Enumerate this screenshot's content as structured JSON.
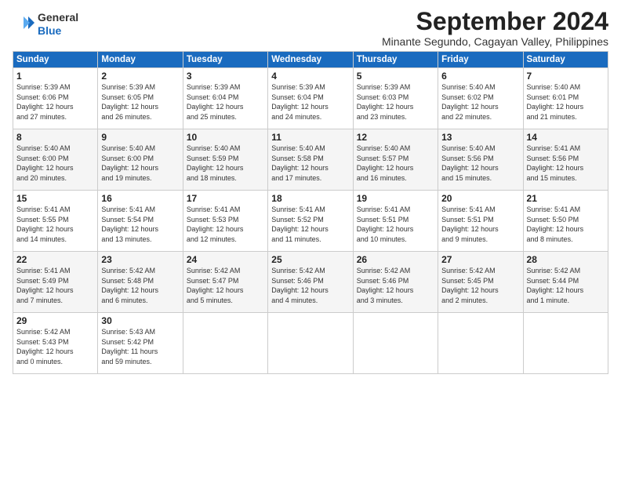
{
  "header": {
    "logo_line1": "General",
    "logo_line2": "Blue",
    "month_title": "September 2024",
    "location": "Minante Segundo, Cagayan Valley, Philippines"
  },
  "days_of_week": [
    "Sunday",
    "Monday",
    "Tuesday",
    "Wednesday",
    "Thursday",
    "Friday",
    "Saturday"
  ],
  "weeks": [
    [
      {
        "day": "1",
        "detail": "Sunrise: 5:39 AM\nSunset: 6:06 PM\nDaylight: 12 hours\nand 27 minutes."
      },
      {
        "day": "2",
        "detail": "Sunrise: 5:39 AM\nSunset: 6:05 PM\nDaylight: 12 hours\nand 26 minutes."
      },
      {
        "day": "3",
        "detail": "Sunrise: 5:39 AM\nSunset: 6:04 PM\nDaylight: 12 hours\nand 25 minutes."
      },
      {
        "day": "4",
        "detail": "Sunrise: 5:39 AM\nSunset: 6:04 PM\nDaylight: 12 hours\nand 24 minutes."
      },
      {
        "day": "5",
        "detail": "Sunrise: 5:39 AM\nSunset: 6:03 PM\nDaylight: 12 hours\nand 23 minutes."
      },
      {
        "day": "6",
        "detail": "Sunrise: 5:40 AM\nSunset: 6:02 PM\nDaylight: 12 hours\nand 22 minutes."
      },
      {
        "day": "7",
        "detail": "Sunrise: 5:40 AM\nSunset: 6:01 PM\nDaylight: 12 hours\nand 21 minutes."
      }
    ],
    [
      {
        "day": "8",
        "detail": "Sunrise: 5:40 AM\nSunset: 6:00 PM\nDaylight: 12 hours\nand 20 minutes."
      },
      {
        "day": "9",
        "detail": "Sunrise: 5:40 AM\nSunset: 6:00 PM\nDaylight: 12 hours\nand 19 minutes."
      },
      {
        "day": "10",
        "detail": "Sunrise: 5:40 AM\nSunset: 5:59 PM\nDaylight: 12 hours\nand 18 minutes."
      },
      {
        "day": "11",
        "detail": "Sunrise: 5:40 AM\nSunset: 5:58 PM\nDaylight: 12 hours\nand 17 minutes."
      },
      {
        "day": "12",
        "detail": "Sunrise: 5:40 AM\nSunset: 5:57 PM\nDaylight: 12 hours\nand 16 minutes."
      },
      {
        "day": "13",
        "detail": "Sunrise: 5:40 AM\nSunset: 5:56 PM\nDaylight: 12 hours\nand 15 minutes."
      },
      {
        "day": "14",
        "detail": "Sunrise: 5:41 AM\nSunset: 5:56 PM\nDaylight: 12 hours\nand 15 minutes."
      }
    ],
    [
      {
        "day": "15",
        "detail": "Sunrise: 5:41 AM\nSunset: 5:55 PM\nDaylight: 12 hours\nand 14 minutes."
      },
      {
        "day": "16",
        "detail": "Sunrise: 5:41 AM\nSunset: 5:54 PM\nDaylight: 12 hours\nand 13 minutes."
      },
      {
        "day": "17",
        "detail": "Sunrise: 5:41 AM\nSunset: 5:53 PM\nDaylight: 12 hours\nand 12 minutes."
      },
      {
        "day": "18",
        "detail": "Sunrise: 5:41 AM\nSunset: 5:52 PM\nDaylight: 12 hours\nand 11 minutes."
      },
      {
        "day": "19",
        "detail": "Sunrise: 5:41 AM\nSunset: 5:51 PM\nDaylight: 12 hours\nand 10 minutes."
      },
      {
        "day": "20",
        "detail": "Sunrise: 5:41 AM\nSunset: 5:51 PM\nDaylight: 12 hours\nand 9 minutes."
      },
      {
        "day": "21",
        "detail": "Sunrise: 5:41 AM\nSunset: 5:50 PM\nDaylight: 12 hours\nand 8 minutes."
      }
    ],
    [
      {
        "day": "22",
        "detail": "Sunrise: 5:41 AM\nSunset: 5:49 PM\nDaylight: 12 hours\nand 7 minutes."
      },
      {
        "day": "23",
        "detail": "Sunrise: 5:42 AM\nSunset: 5:48 PM\nDaylight: 12 hours\nand 6 minutes."
      },
      {
        "day": "24",
        "detail": "Sunrise: 5:42 AM\nSunset: 5:47 PM\nDaylight: 12 hours\nand 5 minutes."
      },
      {
        "day": "25",
        "detail": "Sunrise: 5:42 AM\nSunset: 5:46 PM\nDaylight: 12 hours\nand 4 minutes."
      },
      {
        "day": "26",
        "detail": "Sunrise: 5:42 AM\nSunset: 5:46 PM\nDaylight: 12 hours\nand 3 minutes."
      },
      {
        "day": "27",
        "detail": "Sunrise: 5:42 AM\nSunset: 5:45 PM\nDaylight: 12 hours\nand 2 minutes."
      },
      {
        "day": "28",
        "detail": "Sunrise: 5:42 AM\nSunset: 5:44 PM\nDaylight: 12 hours\nand 1 minute."
      }
    ],
    [
      {
        "day": "29",
        "detail": "Sunrise: 5:42 AM\nSunset: 5:43 PM\nDaylight: 12 hours\nand 0 minutes."
      },
      {
        "day": "30",
        "detail": "Sunrise: 5:43 AM\nSunset: 5:42 PM\nDaylight: 11 hours\nand 59 minutes."
      },
      {
        "day": "",
        "detail": ""
      },
      {
        "day": "",
        "detail": ""
      },
      {
        "day": "",
        "detail": ""
      },
      {
        "day": "",
        "detail": ""
      },
      {
        "day": "",
        "detail": ""
      }
    ]
  ]
}
